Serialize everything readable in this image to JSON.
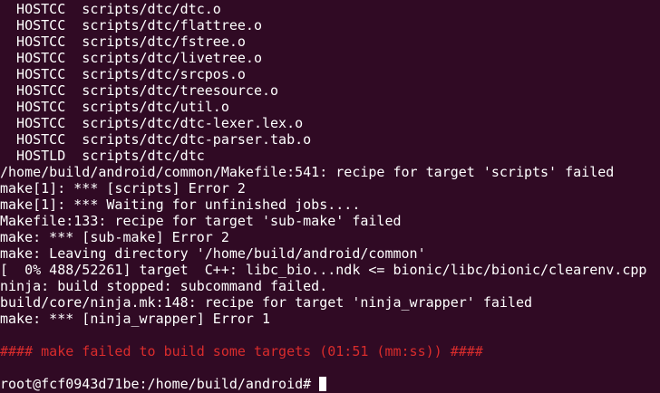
{
  "terminal": {
    "lines": [
      "  HOSTCC  scripts/dtc/dtc.o",
      "  HOSTCC  scripts/dtc/flattree.o",
      "  HOSTCC  scripts/dtc/fstree.o",
      "  HOSTCC  scripts/dtc/livetree.o",
      "  HOSTCC  scripts/dtc/srcpos.o",
      "  HOSTCC  scripts/dtc/treesource.o",
      "  HOSTCC  scripts/dtc/util.o",
      "  HOSTCC  scripts/dtc/dtc-lexer.lex.o",
      "  HOSTCC  scripts/dtc/dtc-parser.tab.o",
      "  HOSTLD  scripts/dtc/dtc",
      "/home/build/android/common/Makefile:541: recipe for target 'scripts' failed",
      "make[1]: *** [scripts] Error 2",
      "make[1]: *** Waiting for unfinished jobs....",
      "Makefile:133: recipe for target 'sub-make' failed",
      "make: *** [sub-make] Error 2",
      "make: Leaving directory '/home/build/android/common'",
      "[  0% 488/52261] target  C++: libc_bio...ndk <= bionic/libc/bionic/clearenv.cpp",
      "ninja: build stopped: subcommand failed.",
      "build/core/ninja.mk:148: recipe for target 'ninja_wrapper' failed",
      "make: *** [ninja_wrapper] Error 1",
      "",
      "#### make failed to build some targets (01:51 (mm:ss)) ####",
      ""
    ],
    "prompt": "root@fcf0943d71be:/home/build/android# ",
    "colors": {
      "background": "#300a24",
      "foreground": "#ffffff",
      "error": "#d92c2c"
    }
  }
}
